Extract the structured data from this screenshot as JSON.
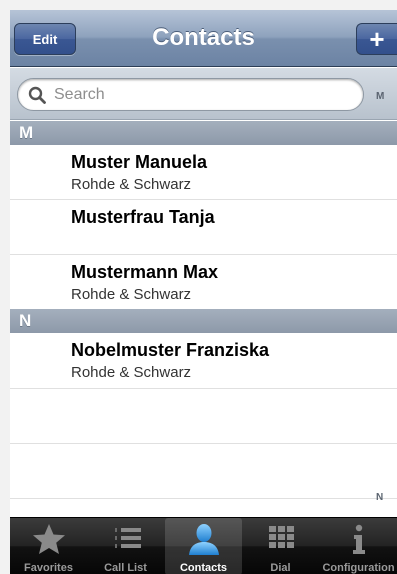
{
  "navbar": {
    "title": "Contacts",
    "edit_label": "Edit",
    "add_label": "+"
  },
  "search": {
    "placeholder": "Search",
    "index_top": "M"
  },
  "sections": [
    {
      "letter": "M",
      "contacts": [
        {
          "name": "Muster Manuela",
          "company": "Rohde & Schwarz"
        },
        {
          "name": "Musterfrau Tanja",
          "company": ""
        },
        {
          "name": "Mustermann Max",
          "company": "Rohde & Schwarz"
        }
      ]
    },
    {
      "letter": "N",
      "contacts": [
        {
          "name": "Nobelmuster Franziska",
          "company": "Rohde & Schwarz"
        }
      ]
    }
  ],
  "index_bottom": "N",
  "tabbar": {
    "active_tab": "Contacts",
    "tabs": [
      {
        "label": "Favorites",
        "icon": "star-icon"
      },
      {
        "label": "Call List",
        "icon": "list-icon"
      },
      {
        "label": "Contacts",
        "icon": "person-icon"
      },
      {
        "label": "Dial",
        "icon": "keypad-icon"
      },
      {
        "label": "Configuration",
        "icon": "info-icon"
      }
    ]
  },
  "colors": {
    "nav_blue": "#6c83a4",
    "button_blue": "#3a5793",
    "tab_active_icon": "#3aa0e8"
  }
}
